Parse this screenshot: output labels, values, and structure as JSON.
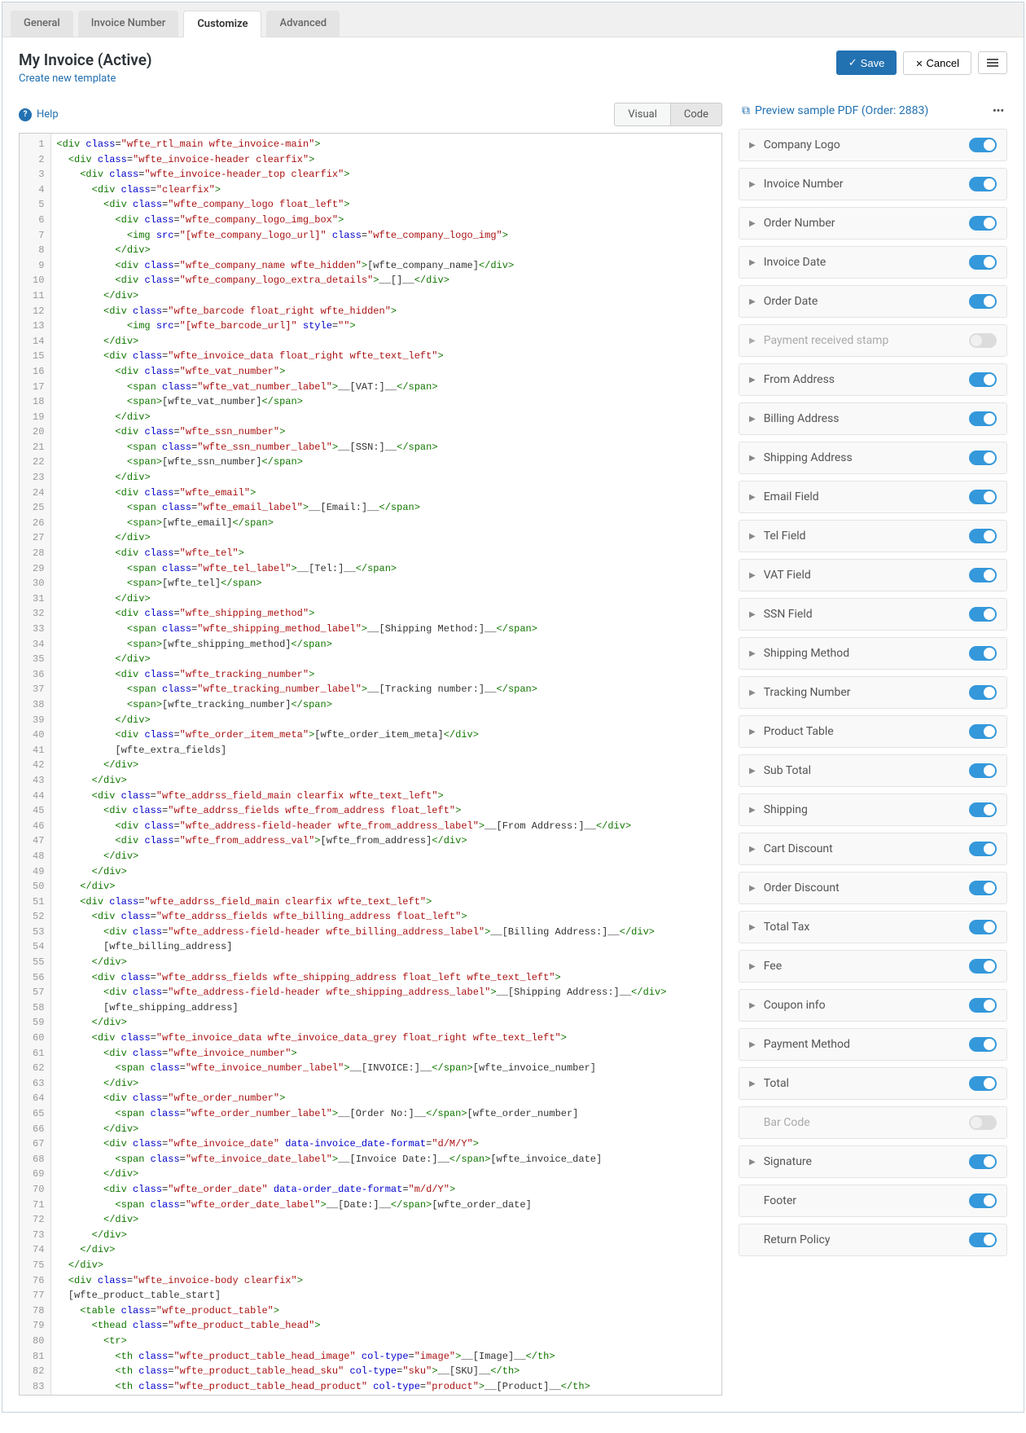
{
  "tabs": [
    "General",
    "Invoice Number",
    "Customize",
    "Advanced"
  ],
  "active_tab": 2,
  "title": "My Invoice (Active)",
  "create_link": "Create new template",
  "buttons": {
    "save": "Save",
    "cancel": "Cancel"
  },
  "help": "Help",
  "editor_tabs": {
    "visual": "Visual",
    "code": "Code",
    "active": "code"
  },
  "preview": "Preview sample PDF (Order: 2883)",
  "panels": [
    {
      "label": "Company Logo",
      "on": true,
      "chev": true
    },
    {
      "label": "Invoice Number",
      "on": true,
      "chev": true
    },
    {
      "label": "Order Number",
      "on": true,
      "chev": true
    },
    {
      "label": "Invoice Date",
      "on": true,
      "chev": true
    },
    {
      "label": "Order Date",
      "on": true,
      "chev": true
    },
    {
      "label": "Payment received stamp",
      "on": false,
      "chev": true
    },
    {
      "label": "From Address",
      "on": true,
      "chev": true
    },
    {
      "label": "Billing Address",
      "on": true,
      "chev": true
    },
    {
      "label": "Shipping Address",
      "on": true,
      "chev": true
    },
    {
      "label": "Email Field",
      "on": true,
      "chev": true
    },
    {
      "label": "Tel Field",
      "on": true,
      "chev": true
    },
    {
      "label": "VAT Field",
      "on": true,
      "chev": true
    },
    {
      "label": "SSN Field",
      "on": true,
      "chev": true
    },
    {
      "label": "Shipping Method",
      "on": true,
      "chev": true
    },
    {
      "label": "Tracking Number",
      "on": true,
      "chev": true
    },
    {
      "label": "Product Table",
      "on": true,
      "chev": true
    },
    {
      "label": "Sub Total",
      "on": true,
      "chev": true
    },
    {
      "label": "Shipping",
      "on": true,
      "chev": true
    },
    {
      "label": "Cart Discount",
      "on": true,
      "chev": true
    },
    {
      "label": "Order Discount",
      "on": true,
      "chev": true
    },
    {
      "label": "Total Tax",
      "on": true,
      "chev": true
    },
    {
      "label": "Fee",
      "on": true,
      "chev": true
    },
    {
      "label": "Coupon info",
      "on": true,
      "chev": true
    },
    {
      "label": "Payment Method",
      "on": true,
      "chev": true
    },
    {
      "label": "Total",
      "on": true,
      "chev": true
    },
    {
      "label": "Bar Code",
      "on": false,
      "chev": false
    },
    {
      "label": "Signature",
      "on": true,
      "chev": true
    },
    {
      "label": "Footer",
      "on": true,
      "chev": false
    },
    {
      "label": "Return Policy",
      "on": true,
      "chev": false
    }
  ],
  "code_lines": [
    "<div class=\"wfte_rtl_main wfte_invoice-main\">",
    "  <div class=\"wfte_invoice-header clearfix\">",
    "    <div class=\"wfte_invoice-header_top clearfix\">",
    "      <div class=\"clearfix\">",
    "        <div class=\"wfte_company_logo float_left\">",
    "          <div class=\"wfte_company_logo_img_box\">",
    "            <img src=\"[wfte_company_logo_url]\" class=\"wfte_company_logo_img\">",
    "          </div>",
    "          <div class=\"wfte_company_name wfte_hidden\">[wfte_company_name]</div>",
    "          <div class=\"wfte_company_logo_extra_details\">__[]__</div>",
    "        </div>",
    "        <div class=\"wfte_barcode float_right wfte_hidden\">",
    "            <img src=\"[wfte_barcode_url]\" style=\"\">",
    "        </div>",
    "        <div class=\"wfte_invoice_data float_right wfte_text_left\">",
    "          <div class=\"wfte_vat_number\">",
    "            <span class=\"wfte_vat_number_label\">__[VAT:]__</span>",
    "            <span>[wfte_vat_number]</span>",
    "          </div>",
    "          <div class=\"wfte_ssn_number\">",
    "            <span class=\"wfte_ssn_number_label\">__[SSN:]__</span>",
    "            <span>[wfte_ssn_number]</span>",
    "          </div>",
    "          <div class=\"wfte_email\">",
    "            <span class=\"wfte_email_label\">__[Email:]__</span>",
    "            <span>[wfte_email]</span>",
    "          </div>",
    "          <div class=\"wfte_tel\">",
    "            <span class=\"wfte_tel_label\">__[Tel:]__</span>",
    "            <span>[wfte_tel]</span>",
    "          </div>",
    "          <div class=\"wfte_shipping_method\">",
    "            <span class=\"wfte_shipping_method_label\">__[Shipping Method:]__</span>",
    "            <span>[wfte_shipping_method]</span>",
    "          </div>",
    "          <div class=\"wfte_tracking_number\">",
    "            <span class=\"wfte_tracking_number_label\">__[Tracking number:]__</span>",
    "            <span>[wfte_tracking_number]</span>",
    "          </div>",
    "          <div class=\"wfte_order_item_meta\">[wfte_order_item_meta]</div>",
    "          [wfte_extra_fields]",
    "        </div>",
    "      </div>",
    "      <div class=\"wfte_addrss_field_main clearfix wfte_text_left\">",
    "        <div class=\"wfte_addrss_fields wfte_from_address float_left\">",
    "          <div class=\"wfte_address-field-header wfte_from_address_label\">__[From Address:]__</div>",
    "          <div class=\"wfte_from_address_val\">[wfte_from_address]</div>",
    "        </div>",
    "      </div>",
    "    </div>",
    "    <div class=\"wfte_addrss_field_main clearfix wfte_text_left\">",
    "      <div class=\"wfte_addrss_fields wfte_billing_address float_left\">",
    "        <div class=\"wfte_address-field-header wfte_billing_address_label\">__[Billing Address:]__</div>",
    "        [wfte_billing_address]",
    "      </div>",
    "      <div class=\"wfte_addrss_fields wfte_shipping_address float_left wfte_text_left\">",
    "        <div class=\"wfte_address-field-header wfte_shipping_address_label\">__[Shipping Address:]__</div>",
    "        [wfte_shipping_address]",
    "      </div>",
    "      <div class=\"wfte_invoice_data wfte_invoice_data_grey float_right wfte_text_left\">",
    "        <div class=\"wfte_invoice_number\">",
    "          <span class=\"wfte_invoice_number_label\">__[INVOICE:]__</span>[wfte_invoice_number]",
    "        </div>",
    "        <div class=\"wfte_order_number\">",
    "          <span class=\"wfte_order_number_label\">__[Order No:]__</span>[wfte_order_number]",
    "        </div>",
    "        <div class=\"wfte_invoice_date\" data-invoice_date-format=\"d/M/Y\">",
    "          <span class=\"wfte_invoice_date_label\">__[Invoice Date:]__</span>[wfte_invoice_date]",
    "        </div>",
    "        <div class=\"wfte_order_date\" data-order_date-format=\"m/d/Y\">",
    "          <span class=\"wfte_order_date_label\">__[Date:]__</span>[wfte_order_date]",
    "        </div>",
    "      </div>",
    "    </div>",
    "  </div>",
    "  <div class=\"wfte_invoice-body clearfix\">",
    "  [wfte_product_table_start]",
    "    <table class=\"wfte_product_table\">",
    "      <thead class=\"wfte_product_table_head\">",
    "        <tr>",
    "          <th class=\"wfte_product_table_head_image\" col-type=\"image\">__[Image]__</th>",
    "          <th class=\"wfte_product_table_head_sku\" col-type=\"sku\">__[SKU]__</th>",
    "          <th class=\"wfte_product_table_head_product\" col-type=\"product\">__[Product]__</th>"
  ]
}
